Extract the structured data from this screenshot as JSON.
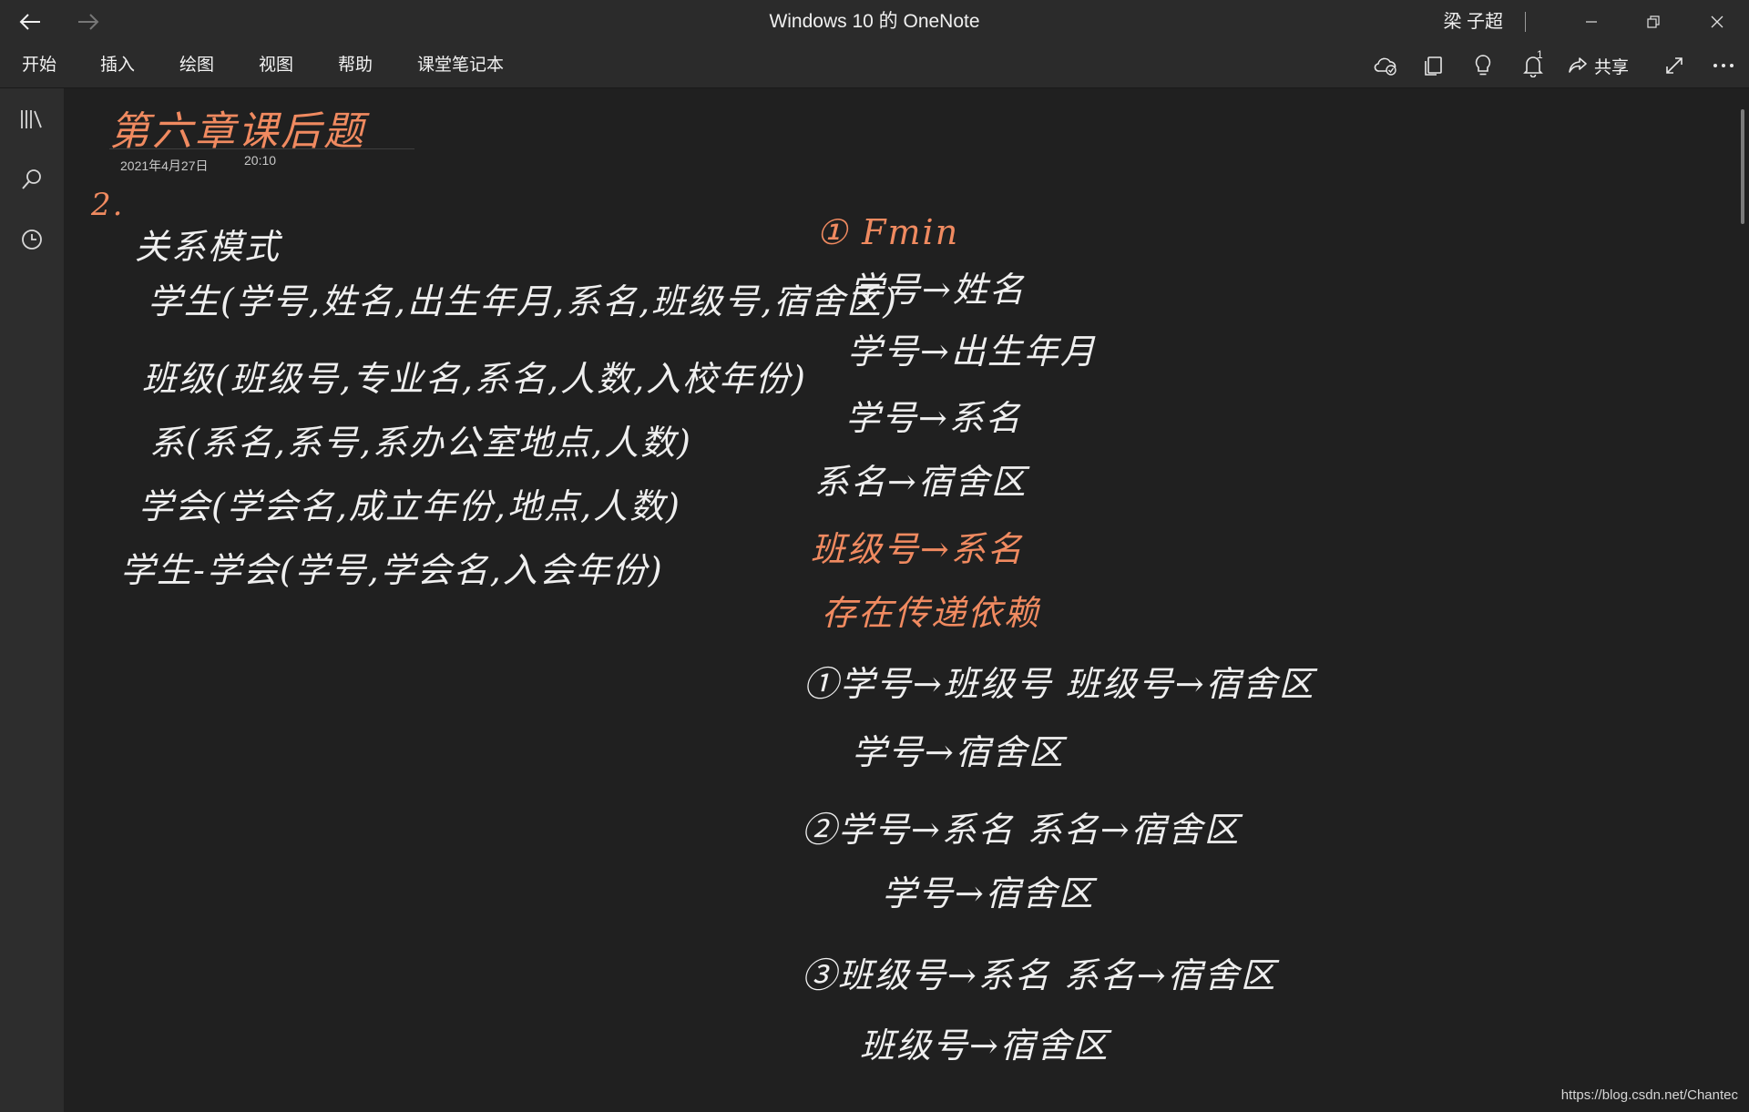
{
  "titlebar": {
    "app_title": "Windows 10 的 OneNote",
    "user_name": "梁 子超"
  },
  "ribbon": {
    "tabs": [
      "开始",
      "插入",
      "绘图",
      "视图",
      "帮助",
      "课堂笔记本"
    ],
    "notification_count": "1",
    "share_label": "共享"
  },
  "page": {
    "title": "第六章课后题",
    "date": "2021年4月27日",
    "time": "20:10"
  },
  "notes_left": [
    "2.",
    "关系模式",
    "学生(学号,姓名,出生年月,系名,班级号,宿舍区)",
    "班级(班级号,专业名,系名,人数,入校年份)",
    "系(系名,系号,系办公室地点,人数)",
    "学会(学会名,成立年份,地点,人数)",
    "学生-学会(学号,学会名,入会年份)"
  ],
  "notes_right": [
    "① Fmin",
    "学号→姓名",
    "学号→出生年月",
    "学号→系名",
    "系名→宿舍区",
    "班级号→系名",
    "存在传递依赖",
    "①学号→班级号   班级号→宿舍区",
    "学号→宿舍区",
    "②学号→系名   系名→宿舍区",
    "学号→宿舍区",
    "③班级号→系名   系名→宿舍区",
    "班级号→宿舍区"
  ],
  "watermark": "https://blog.csdn.net/Chantec",
  "colors": {
    "background": "#202020",
    "chrome": "#2b2b2b",
    "ink_white": "#efefef",
    "ink_orange": "#f08a60"
  }
}
